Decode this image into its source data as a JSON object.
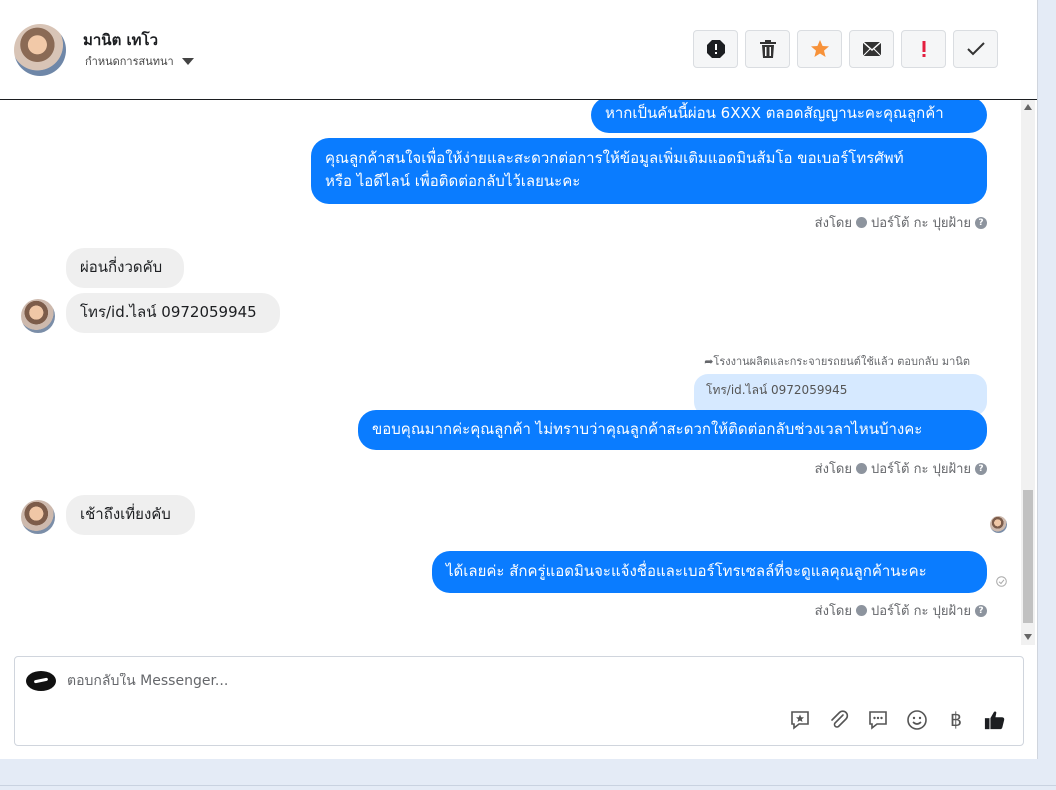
{
  "header": {
    "contact_name": "มานิต เทโว",
    "assign_label": "กำหนดการสนทนา",
    "toolbar": [
      {
        "name": "report-icon"
      },
      {
        "name": "trash-icon"
      },
      {
        "name": "star-icon",
        "color": "#f7923a"
      },
      {
        "name": "mail-icon"
      },
      {
        "name": "exclamation-icon",
        "color": "#e41e3f"
      },
      {
        "name": "check-icon"
      }
    ]
  },
  "messages": {
    "m1": "หากเป็นคันนี้ผ่อน 6XXX ตลอดสัญญานะคะคุณลูกค้า",
    "m2_line1": "คุณลูกค้าสนใจเพื่อให้ง่ายและสะดวกต่อการให้ข้อมูลเพิ่มเติมแอดมินส้มโอ ขอเบอร์โทรศัพท์",
    "m2_line2": "หรือ ไอดีไลน์ เพื่อติดต่อกลับไว้เลยนะคะ",
    "sent_by_1": "ส่งโดย",
    "sender_1": "ปอร์โต้ กะ ปุยฝ้าย",
    "in1": "ผ่อนกี่งวดคับ",
    "in2": "โทร/id.ไลน์ 0972059945",
    "reply_note": "โรงงานผลิตและกระจายรถยนต์ใช้แล้ว ตอบกลับ มานิต",
    "quoted_text": "โทร/id.ไลน์ 0972059945",
    "m3": "ขอบคุณมากค่ะคุณลูกค้า ไม่ทราบว่าคุณลูกค้าสะดวกให้ติดต่อกลับช่วงเวลาไหนบ้างคะ",
    "sent_by_2": "ส่งโดย",
    "sender_2": "ปอร์โต้ กะ ปุยฝ้าย",
    "in3": "เช้าถึงเที่ยงคับ",
    "m4": "ได้เลยค่ะ สักครู่แอดมินจะแจ้งชื่อและเบอร์โทรเซลล์ที่จะดูแลคุณลูกค้านะคะ",
    "sent_by_3": "ส่งโดย",
    "sender_3": "ปอร์โต้ กะ ปุยฝ้าย",
    "help_glyph": "?"
  },
  "composer": {
    "placeholder": "ตอบกลับใน Messenger...",
    "tools": [
      "saved-reply-icon",
      "attachment-icon",
      "comment-icon",
      "emoji-icon",
      "baht-icon",
      "like-icon"
    ],
    "baht_glyph": "฿"
  },
  "colors": {
    "outgoing": "#0a7cff",
    "incoming": "#efefef"
  }
}
